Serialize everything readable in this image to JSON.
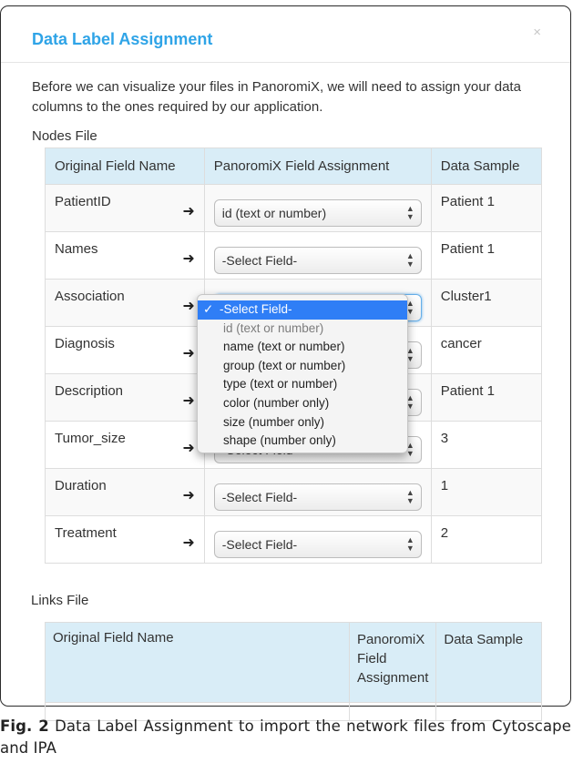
{
  "modal": {
    "title": "Data Label Assignment",
    "close_glyph": "×",
    "intro": "Before we can visualize your files in PanoromiX, we will need to assign your data columns to the ones required by our application."
  },
  "nodes": {
    "section_label": "Nodes File",
    "headers": [
      "Original Field Name",
      "PanoromiX Field Assignment",
      "Data Sample"
    ],
    "rows": [
      {
        "field": "PatientID",
        "assignment": "id (text or number)",
        "sample": "Patient 1"
      },
      {
        "field": "Names",
        "assignment": "-Select Field-",
        "sample": "Patient 1"
      },
      {
        "field": "Association",
        "assignment": "-Select Field-",
        "sample": "Cluster1"
      },
      {
        "field": "Diagnosis",
        "assignment": "-Select Field-",
        "sample": "cancer"
      },
      {
        "field": "Description",
        "assignment": "-Select Field-",
        "sample": "Patient 1"
      },
      {
        "field": "Tumor_size",
        "assignment": "-Select Field-",
        "sample": "3"
      },
      {
        "field": "Duration",
        "assignment": "-Select Field-",
        "sample": "1"
      },
      {
        "field": "Treatment",
        "assignment": "-Select Field-",
        "sample": "2"
      }
    ]
  },
  "dropdown": {
    "check": "✓",
    "options": [
      "-Select Field-",
      "id (text or number)",
      "name (text or number)",
      "group (text or number)",
      "type (text or number)",
      "color (number only)",
      "size (number only)",
      "shape (number only)"
    ],
    "selected": "-Select Field-"
  },
  "links": {
    "section_label": "Links File",
    "headers": [
      "Original Field Name",
      "PanoromiX Field Assignment",
      "Data Sample"
    ]
  },
  "caption": {
    "label": "Fig. 2",
    "text": " Data Label Assignment to import the network files from Cytoscape and IPA"
  },
  "colors": {
    "title": "#2fa4e7",
    "header_bg": "#d9edf7",
    "selected_option": "#2f7ef6"
  },
  "icons": {
    "row_arrow": "right-arrow-icon",
    "select_arrows": "updown-chevron-icon",
    "close": "close-icon"
  }
}
